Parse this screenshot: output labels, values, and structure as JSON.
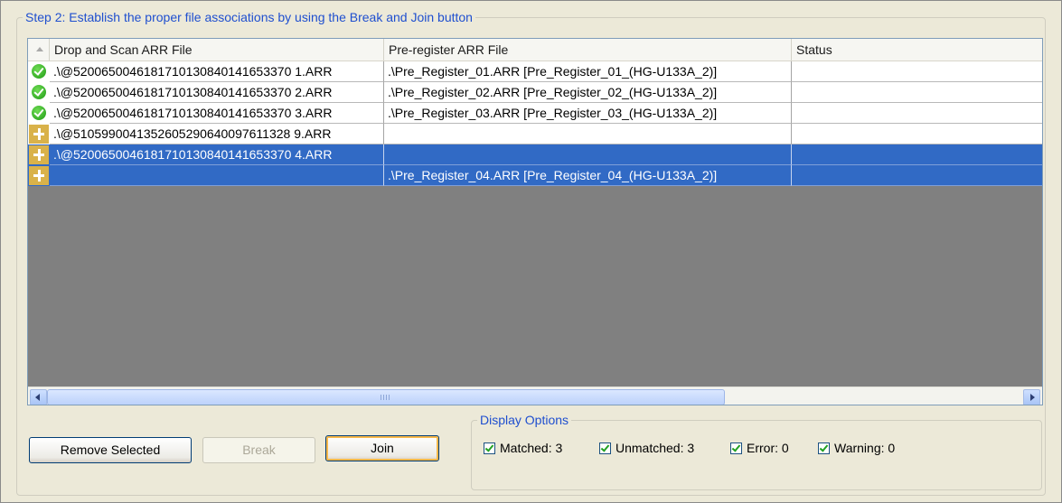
{
  "group": {
    "legend": "Step 2: Establish the proper file associations by using the Break and Join button"
  },
  "table": {
    "columns": [
      "Drop and Scan ARR File",
      "Pre-register ARR File",
      "Status"
    ],
    "rows": [
      {
        "icon": "check-icon",
        "scan": ".\\@5200650046181710130840141653370 1.ARR",
        "pre": ".\\Pre_Register_01.ARR [Pre_Register_01_(HG-U133A_2)]",
        "status": ""
      },
      {
        "icon": "check-icon",
        "scan": ".\\@5200650046181710130840141653370 2.ARR",
        "pre": ".\\Pre_Register_02.ARR [Pre_Register_02_(HG-U133A_2)]",
        "status": ""
      },
      {
        "icon": "check-icon",
        "scan": ".\\@5200650046181710130840141653370 3.ARR",
        "pre": ".\\Pre_Register_03.ARR [Pre_Register_03_(HG-U133A_2)]",
        "status": ""
      },
      {
        "icon": "plus-icon",
        "scan": ".\\@5105990041352605290640097611328 9.ARR",
        "pre": "",
        "status": ""
      },
      {
        "icon": "plus-icon",
        "scan": ".\\@5200650046181710130840141653370 4.ARR",
        "pre": "",
        "status": ""
      },
      {
        "icon": "plus-icon",
        "scan": "",
        "pre": ".\\Pre_Register_04.ARR [Pre_Register_04_(HG-U133A_2)]",
        "status": ""
      }
    ]
  },
  "buttons": {
    "remove": "Remove Selected",
    "break": "Break",
    "join": "Join"
  },
  "display_options": {
    "legend": "Display Options",
    "matched": "Matched: 3",
    "unmatched": "Unmatched: 3",
    "error": "Error: 0",
    "warning": "Warning: 0"
  }
}
